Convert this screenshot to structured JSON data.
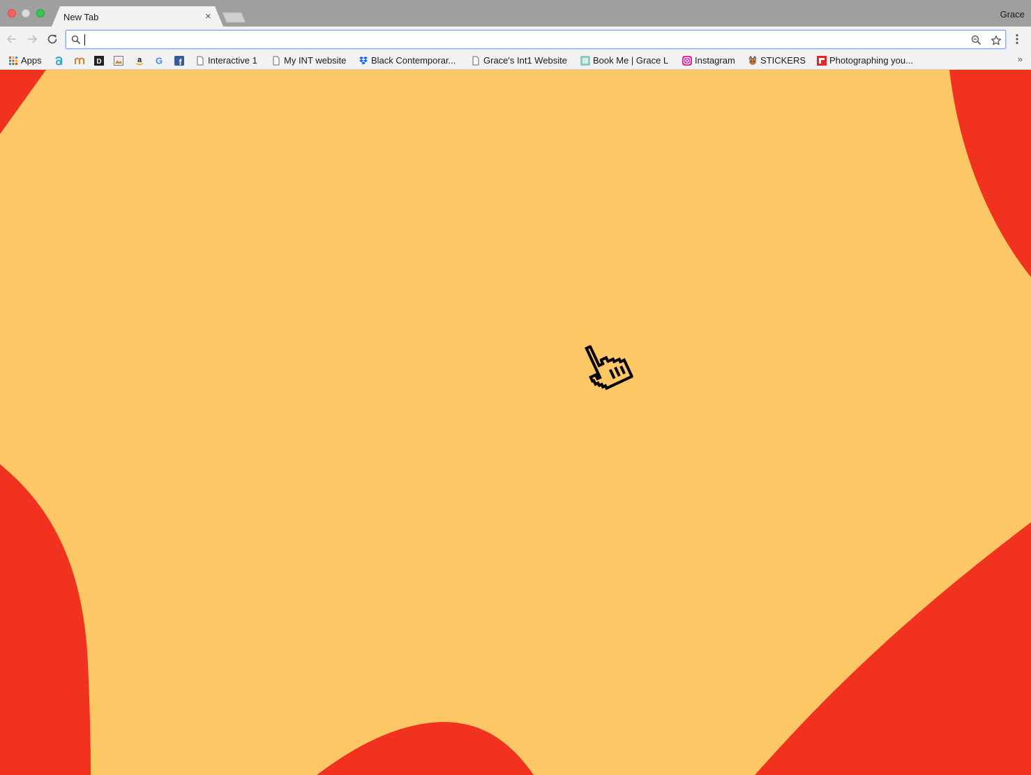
{
  "window": {
    "profile_name": "Grace"
  },
  "tab": {
    "title": "New Tab",
    "close_glyph": "×"
  },
  "omnibox": {
    "value": "",
    "icons": [
      "search-icon",
      "zoom-icon",
      "bookmark-star-icon"
    ]
  },
  "bookmarks": [
    {
      "label": "Apps",
      "icon": "apps-grid-icon"
    },
    {
      "label": "",
      "icon": "a-logo-icon"
    },
    {
      "label": "",
      "icon": "m-logo-icon"
    },
    {
      "label": "",
      "icon": "d-logo-icon"
    },
    {
      "label": "",
      "icon": "image-icon"
    },
    {
      "label": "",
      "icon": "amazon-icon"
    },
    {
      "label": "",
      "icon": "google-icon"
    },
    {
      "label": "",
      "icon": "facebook-icon"
    },
    {
      "label": "Interactive 1",
      "icon": "page-icon"
    },
    {
      "label": "My INT website",
      "icon": "page-icon"
    },
    {
      "label": "Black Contemporar...",
      "icon": "dropbox-icon"
    },
    {
      "label": "Grace's Int1 Website",
      "icon": "page-icon"
    },
    {
      "label": "Book Me | Grace L",
      "icon": "site-icon"
    },
    {
      "label": "Instagram",
      "icon": "instagram-icon"
    },
    {
      "label": "STICKERS",
      "icon": "sticker-icon"
    },
    {
      "label": "Photographing you...",
      "icon": "flipboard-icon"
    }
  ],
  "bookmarks_overflow": "»",
  "colors": {
    "page_background": "#fdc765",
    "blob": "#f0321e",
    "titlebar": "#9f9f9f",
    "toolbar": "#f2f2f2"
  }
}
